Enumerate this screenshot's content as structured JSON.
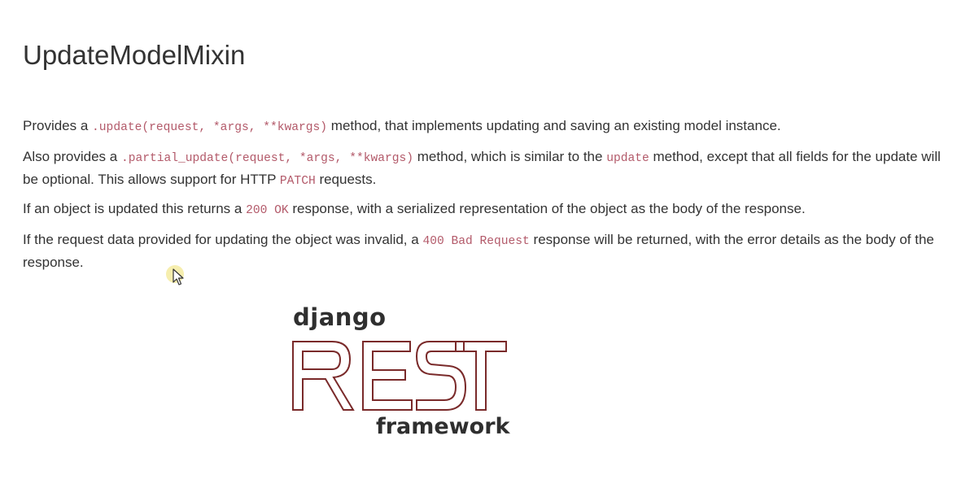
{
  "heading": "UpdateModelMixin",
  "paragraphs": {
    "p1": {
      "t1": "Provides a ",
      "c1": ".update(request, *args, **kwargs)",
      "t2": " method, that implements updating and saving an existing model instance."
    },
    "p2": {
      "t1": "Also provides a ",
      "c1": ".partial_update(request, *args, **kwargs)",
      "t2": " method, which is similar to the ",
      "c2": "update",
      "t3": " method, except that all fields for the update will be optional. This allows support for HTTP ",
      "c3": "PATCH",
      "t4": " requests."
    },
    "p3": {
      "t1": "If an object is updated this returns a ",
      "c1": "200 OK",
      "t2": " response, with a serialized representation of the object as the body of the response."
    },
    "p4": {
      "t1": "If the request data provided for updating the object was invalid, a ",
      "c1": "400 Bad Request",
      "t2": " response will be returned, with the error details as the body of the response."
    }
  },
  "logo": {
    "top_text": "django",
    "main_text": "REST",
    "bottom_text": "framework",
    "color": "#7a2a2a"
  },
  "colors": {
    "text": "#333333",
    "code": "#b35a6a",
    "cursor_highlight": "#f5eba0"
  },
  "icons": {
    "cursor": "mouse-pointer-icon"
  }
}
